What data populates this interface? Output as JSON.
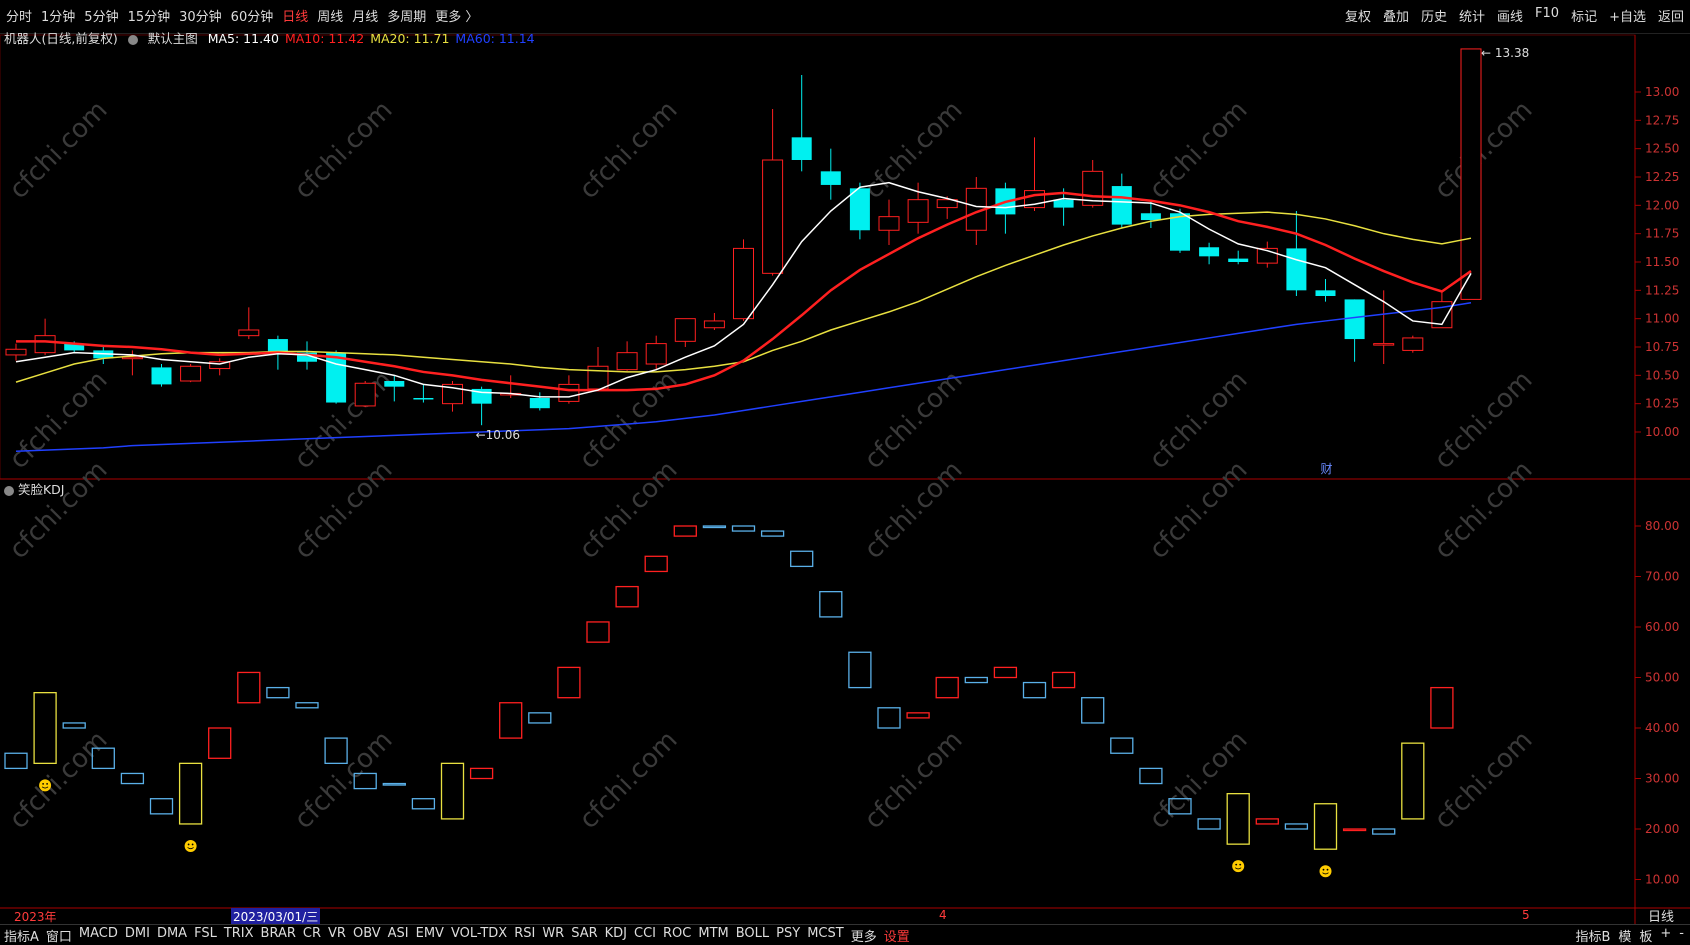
{
  "toolbar": {
    "periods": [
      "分时",
      "1分钟",
      "5分钟",
      "15分钟",
      "30分钟",
      "60分钟",
      "日线",
      "周线",
      "月线",
      "多周期",
      "更多 〉"
    ],
    "active_period": "日线",
    "actions": [
      "复权",
      "叠加",
      "历史",
      "统计",
      "画线",
      "F10",
      "标记",
      "+自选",
      "返回"
    ]
  },
  "main_chart": {
    "title": "机器人(日线,前复权)",
    "template_label": "默认主图",
    "ma": [
      {
        "label": "MA5: 11.40",
        "color": "#ffffff"
      },
      {
        "label": "MA10: 11.42",
        "color": "#ff2020"
      },
      {
        "label": "MA20: 11.71",
        "color": "#e8e040"
      },
      {
        "label": "MA60: 11.14",
        "color": "#2040ff"
      }
    ],
    "high_label": "13.38",
    "low_label": "10.06",
    "finance_marker": "财",
    "y_ticks": [
      "13.00",
      "12.75",
      "12.50",
      "12.25",
      "12.00",
      "11.75",
      "11.50",
      "11.25",
      "11.00",
      "10.75",
      "10.50",
      "10.25",
      "10.00"
    ]
  },
  "kdj_chart": {
    "title": "笑脸KDJ",
    "y_ticks": [
      "80.00",
      "70.00",
      "60.00",
      "50.00",
      "40.00",
      "30.00",
      "20.00",
      "10.00"
    ]
  },
  "date_axis": {
    "year_label": "2023年",
    "cursor_date": "2023/03/01/三",
    "month_markers": [
      "4",
      "5"
    ],
    "period_label": "日线"
  },
  "bottom_tabs": {
    "items": [
      "指标A",
      "窗口",
      "MACD",
      "DMI",
      "DMA",
      "FSL",
      "TRIX",
      "BRAR",
      "CR",
      "VR",
      "OBV",
      "ASI",
      "EMV",
      "VOL-TDX",
      "RSI",
      "WR",
      "SAR",
      "KDJ",
      "CCI",
      "ROC",
      "MTM",
      "BOLL",
      "PSY",
      "MCST",
      "更多",
      "设置"
    ],
    "highlight": "设置",
    "right_items": [
      "指标B",
      "模",
      "板",
      "+",
      "-"
    ]
  },
  "watermark": "cfchi.com",
  "colors": {
    "up": "#ff2020",
    "down": "#00f0f0",
    "ma5": "#ffffff",
    "ma10": "#ff2020",
    "ma20": "#e8e040",
    "ma60": "#2040ff",
    "grid": "#550000",
    "axis_text": "#cc3333"
  },
  "chart_data": {
    "type": "candlestick",
    "candles": [
      {
        "o": 10.68,
        "h": 10.78,
        "l": 10.63,
        "c": 10.73
      },
      {
        "o": 10.7,
        "h": 11.0,
        "l": 10.68,
        "c": 10.85
      },
      {
        "o": 10.78,
        "h": 10.8,
        "l": 10.7,
        "c": 10.72
      },
      {
        "o": 10.72,
        "h": 10.75,
        "l": 10.6,
        "c": 10.65
      },
      {
        "o": 10.65,
        "h": 10.72,
        "l": 10.5,
        "c": 10.66
      },
      {
        "o": 10.57,
        "h": 10.6,
        "l": 10.4,
        "c": 10.42
      },
      {
        "o": 10.45,
        "h": 10.6,
        "l": 10.44,
        "c": 10.58
      },
      {
        "o": 10.56,
        "h": 10.65,
        "l": 10.5,
        "c": 10.62
      },
      {
        "o": 10.85,
        "h": 11.1,
        "l": 10.82,
        "c": 10.9
      },
      {
        "o": 10.82,
        "h": 10.85,
        "l": 10.55,
        "c": 10.7
      },
      {
        "o": 10.7,
        "h": 10.8,
        "l": 10.55,
        "c": 10.62
      },
      {
        "o": 10.7,
        "h": 10.72,
        "l": 10.25,
        "c": 10.26
      },
      {
        "o": 10.23,
        "h": 10.45,
        "l": 10.22,
        "c": 10.43
      },
      {
        "o": 10.45,
        "h": 10.5,
        "l": 10.27,
        "c": 10.4
      },
      {
        "o": 10.3,
        "h": 10.42,
        "l": 10.26,
        "c": 10.29
      },
      {
        "o": 10.25,
        "h": 10.45,
        "l": 10.18,
        "c": 10.42
      },
      {
        "o": 10.38,
        "h": 10.4,
        "l": 10.06,
        "c": 10.25
      },
      {
        "o": 10.33,
        "h": 10.5,
        "l": 10.3,
        "c": 10.34
      },
      {
        "o": 10.3,
        "h": 10.35,
        "l": 10.19,
        "c": 10.21
      },
      {
        "o": 10.27,
        "h": 10.5,
        "l": 10.25,
        "c": 10.42
      },
      {
        "o": 10.38,
        "h": 10.75,
        "l": 10.37,
        "c": 10.58
      },
      {
        "o": 10.55,
        "h": 10.8,
        "l": 10.54,
        "c": 10.7
      },
      {
        "o": 10.6,
        "h": 10.85,
        "l": 10.55,
        "c": 10.78
      },
      {
        "o": 10.8,
        "h": 11.0,
        "l": 10.75,
        "c": 11.0
      },
      {
        "o": 10.92,
        "h": 11.05,
        "l": 10.9,
        "c": 10.98
      },
      {
        "o": 11.0,
        "h": 11.7,
        "l": 10.98,
        "c": 11.62
      },
      {
        "o": 11.4,
        "h": 12.85,
        "l": 11.38,
        "c": 12.4
      },
      {
        "o": 12.6,
        "h": 13.15,
        "l": 12.3,
        "c": 12.4
      },
      {
        "o": 12.3,
        "h": 12.5,
        "l": 12.05,
        "c": 12.18
      },
      {
        "o": 12.15,
        "h": 12.2,
        "l": 11.7,
        "c": 11.78
      },
      {
        "o": 11.78,
        "h": 12.05,
        "l": 11.65,
        "c": 11.9
      },
      {
        "o": 11.85,
        "h": 12.2,
        "l": 11.75,
        "c": 12.05
      },
      {
        "o": 11.98,
        "h": 12.08,
        "l": 11.88,
        "c": 12.05
      },
      {
        "o": 11.78,
        "h": 12.25,
        "l": 11.65,
        "c": 12.15
      },
      {
        "o": 12.15,
        "h": 12.2,
        "l": 11.75,
        "c": 11.92
      },
      {
        "o": 11.98,
        "h": 12.6,
        "l": 11.95,
        "c": 12.13
      },
      {
        "o": 12.05,
        "h": 12.15,
        "l": 11.82,
        "c": 11.98
      },
      {
        "o": 12.0,
        "h": 12.4,
        "l": 11.98,
        "c": 12.3
      },
      {
        "o": 12.17,
        "h": 12.28,
        "l": 11.8,
        "c": 11.83
      },
      {
        "o": 11.93,
        "h": 12.05,
        "l": 11.8,
        "c": 11.87
      },
      {
        "o": 11.93,
        "h": 11.97,
        "l": 11.58,
        "c": 11.6
      },
      {
        "o": 11.63,
        "h": 11.67,
        "l": 11.48,
        "c": 11.55
      },
      {
        "o": 11.53,
        "h": 11.6,
        "l": 11.48,
        "c": 11.5
      },
      {
        "o": 11.49,
        "h": 11.68,
        "l": 11.45,
        "c": 11.62
      },
      {
        "o": 11.62,
        "h": 11.95,
        "l": 11.2,
        "c": 11.25
      },
      {
        "o": 11.25,
        "h": 11.35,
        "l": 11.15,
        "c": 11.2
      },
      {
        "o": 11.17,
        "h": 11.17,
        "l": 10.62,
        "c": 10.82
      },
      {
        "o": 10.78,
        "h": 11.25,
        "l": 10.6,
        "c": 10.78
      },
      {
        "o": 10.72,
        "h": 10.85,
        "l": 10.7,
        "c": 10.83
      },
      {
        "o": 10.92,
        "h": 11.25,
        "l": 10.92,
        "c": 11.15
      },
      {
        "o": 11.17,
        "h": 13.38,
        "l": 11.17,
        "c": 13.38
      }
    ],
    "ma5": [
      10.62,
      10.66,
      10.7,
      10.69,
      10.68,
      10.64,
      10.62,
      10.6,
      10.66,
      10.69,
      10.68,
      10.6,
      10.55,
      10.5,
      10.42,
      10.39,
      10.35,
      10.34,
      10.31,
      10.31,
      10.37,
      10.48,
      10.55,
      10.66,
      10.76,
      10.95,
      11.3,
      11.68,
      11.95,
      12.16,
      12.2,
      12.12,
      12.06,
      11.99,
      11.98,
      12.01,
      12.06,
      12.04,
      12.03,
      12.02,
      11.94,
      11.79,
      11.66,
      11.6,
      11.52,
      11.45,
      11.3,
      11.15,
      10.98,
      10.95,
      11.4
    ],
    "ma10": [
      10.8,
      10.8,
      10.78,
      10.76,
      10.75,
      10.73,
      10.7,
      10.68,
      10.69,
      10.7,
      10.68,
      10.66,
      10.62,
      10.58,
      10.53,
      10.5,
      10.46,
      10.43,
      10.4,
      10.37,
      10.37,
      10.37,
      10.38,
      10.42,
      10.5,
      10.63,
      10.82,
      11.03,
      11.25,
      11.43,
      11.57,
      11.71,
      11.83,
      11.94,
      12.03,
      12.09,
      12.11,
      12.08,
      12.07,
      12.04,
      12.0,
      11.94,
      11.86,
      11.81,
      11.75,
      11.65,
      11.53,
      11.42,
      11.32,
      11.24,
      11.42
    ],
    "ma20": [
      10.44,
      10.52,
      10.6,
      10.65,
      10.67,
      10.69,
      10.7,
      10.7,
      10.7,
      10.71,
      10.71,
      10.7,
      10.69,
      10.68,
      10.66,
      10.64,
      10.62,
      10.6,
      10.57,
      10.55,
      10.54,
      10.53,
      10.53,
      10.55,
      10.58,
      10.62,
      10.72,
      10.8,
      10.9,
      10.98,
      11.06,
      11.15,
      11.26,
      11.37,
      11.47,
      11.56,
      11.65,
      11.73,
      11.8,
      11.86,
      11.9,
      11.92,
      11.93,
      11.94,
      11.92,
      11.88,
      11.82,
      11.75,
      11.7,
      11.66,
      11.71
    ],
    "ma60": [
      9.83,
      9.84,
      9.85,
      9.86,
      9.88,
      9.89,
      9.9,
      9.91,
      9.92,
      9.93,
      9.94,
      9.95,
      9.96,
      9.97,
      9.98,
      9.99,
      10.0,
      10.01,
      10.02,
      10.03,
      10.05,
      10.07,
      10.09,
      10.12,
      10.15,
      10.19,
      10.23,
      10.27,
      10.31,
      10.35,
      10.39,
      10.43,
      10.47,
      10.51,
      10.55,
      10.59,
      10.63,
      10.67,
      10.71,
      10.75,
      10.79,
      10.83,
      10.87,
      10.91,
      10.95,
      10.98,
      11.01,
      11.04,
      11.07,
      11.1,
      11.14
    ],
    "kdj_boxes": [
      {
        "a": 32,
        "b": 35,
        "t": "down"
      },
      {
        "a": 33,
        "b": 47,
        "t": "yellow",
        "smile": true
      },
      {
        "a": 40,
        "b": 41,
        "t": "down"
      },
      {
        "a": 32,
        "b": 36,
        "t": "down"
      },
      {
        "a": 29,
        "b": 31,
        "t": "down"
      },
      {
        "a": 23,
        "b": 26,
        "t": "down"
      },
      {
        "a": 21,
        "b": 33,
        "t": "yellow",
        "smile": true
      },
      {
        "a": 34,
        "b": 40,
        "t": "up"
      },
      {
        "a": 45,
        "b": 51,
        "t": "up"
      },
      {
        "a": 46,
        "b": 48,
        "t": "down"
      },
      {
        "a": 44,
        "b": 45,
        "t": "down"
      },
      {
        "a": 33,
        "b": 38,
        "t": "down"
      },
      {
        "a": 28,
        "b": 31,
        "t": "down"
      },
      {
        "a": 29,
        "b": 29,
        "t": "down"
      },
      {
        "a": 24,
        "b": 26,
        "t": "down"
      },
      {
        "a": 22,
        "b": 33,
        "t": "yellow"
      },
      {
        "a": 30,
        "b": 32,
        "t": "up"
      },
      {
        "a": 38,
        "b": 45,
        "t": "up"
      },
      {
        "a": 41,
        "b": 43,
        "t": "down"
      },
      {
        "a": 46,
        "b": 52,
        "t": "up"
      },
      {
        "a": 57,
        "b": 61,
        "t": "up"
      },
      {
        "a": 64,
        "b": 68,
        "t": "up"
      },
      {
        "a": 71,
        "b": 74,
        "t": "up"
      },
      {
        "a": 78,
        "b": 80,
        "t": "up"
      },
      {
        "a": 80,
        "b": 80,
        "t": "down"
      },
      {
        "a": 79,
        "b": 80,
        "t": "down"
      },
      {
        "a": 78,
        "b": 79,
        "t": "down"
      },
      {
        "a": 72,
        "b": 75,
        "t": "down"
      },
      {
        "a": 62,
        "b": 67,
        "t": "down"
      },
      {
        "a": 48,
        "b": 55,
        "t": "down"
      },
      {
        "a": 40,
        "b": 44,
        "t": "down"
      },
      {
        "a": 42,
        "b": 43,
        "t": "up"
      },
      {
        "a": 46,
        "b": 50,
        "t": "up"
      },
      {
        "a": 49,
        "b": 50,
        "t": "down"
      },
      {
        "a": 50,
        "b": 52,
        "t": "up"
      },
      {
        "a": 46,
        "b": 49,
        "t": "down"
      },
      {
        "a": 48,
        "b": 51,
        "t": "up"
      },
      {
        "a": 41,
        "b": 46,
        "t": "down"
      },
      {
        "a": 35,
        "b": 38,
        "t": "down"
      },
      {
        "a": 29,
        "b": 32,
        "t": "down"
      },
      {
        "a": 23,
        "b": 26,
        "t": "down"
      },
      {
        "a": 20,
        "b": 22,
        "t": "down"
      },
      {
        "a": 17,
        "b": 27,
        "t": "yellow",
        "smile": true
      },
      {
        "a": 21,
        "b": 22,
        "t": "up"
      },
      {
        "a": 20,
        "b": 21,
        "t": "down"
      },
      {
        "a": 16,
        "b": 25,
        "t": "yellow",
        "smile": true
      },
      {
        "a": 20,
        "b": 20,
        "t": "up"
      },
      {
        "a": 19,
        "b": 20,
        "t": "down"
      },
      {
        "a": 22,
        "b": 37,
        "t": "yellow"
      },
      {
        "a": 40,
        "b": 48,
        "t": "up"
      }
    ]
  }
}
